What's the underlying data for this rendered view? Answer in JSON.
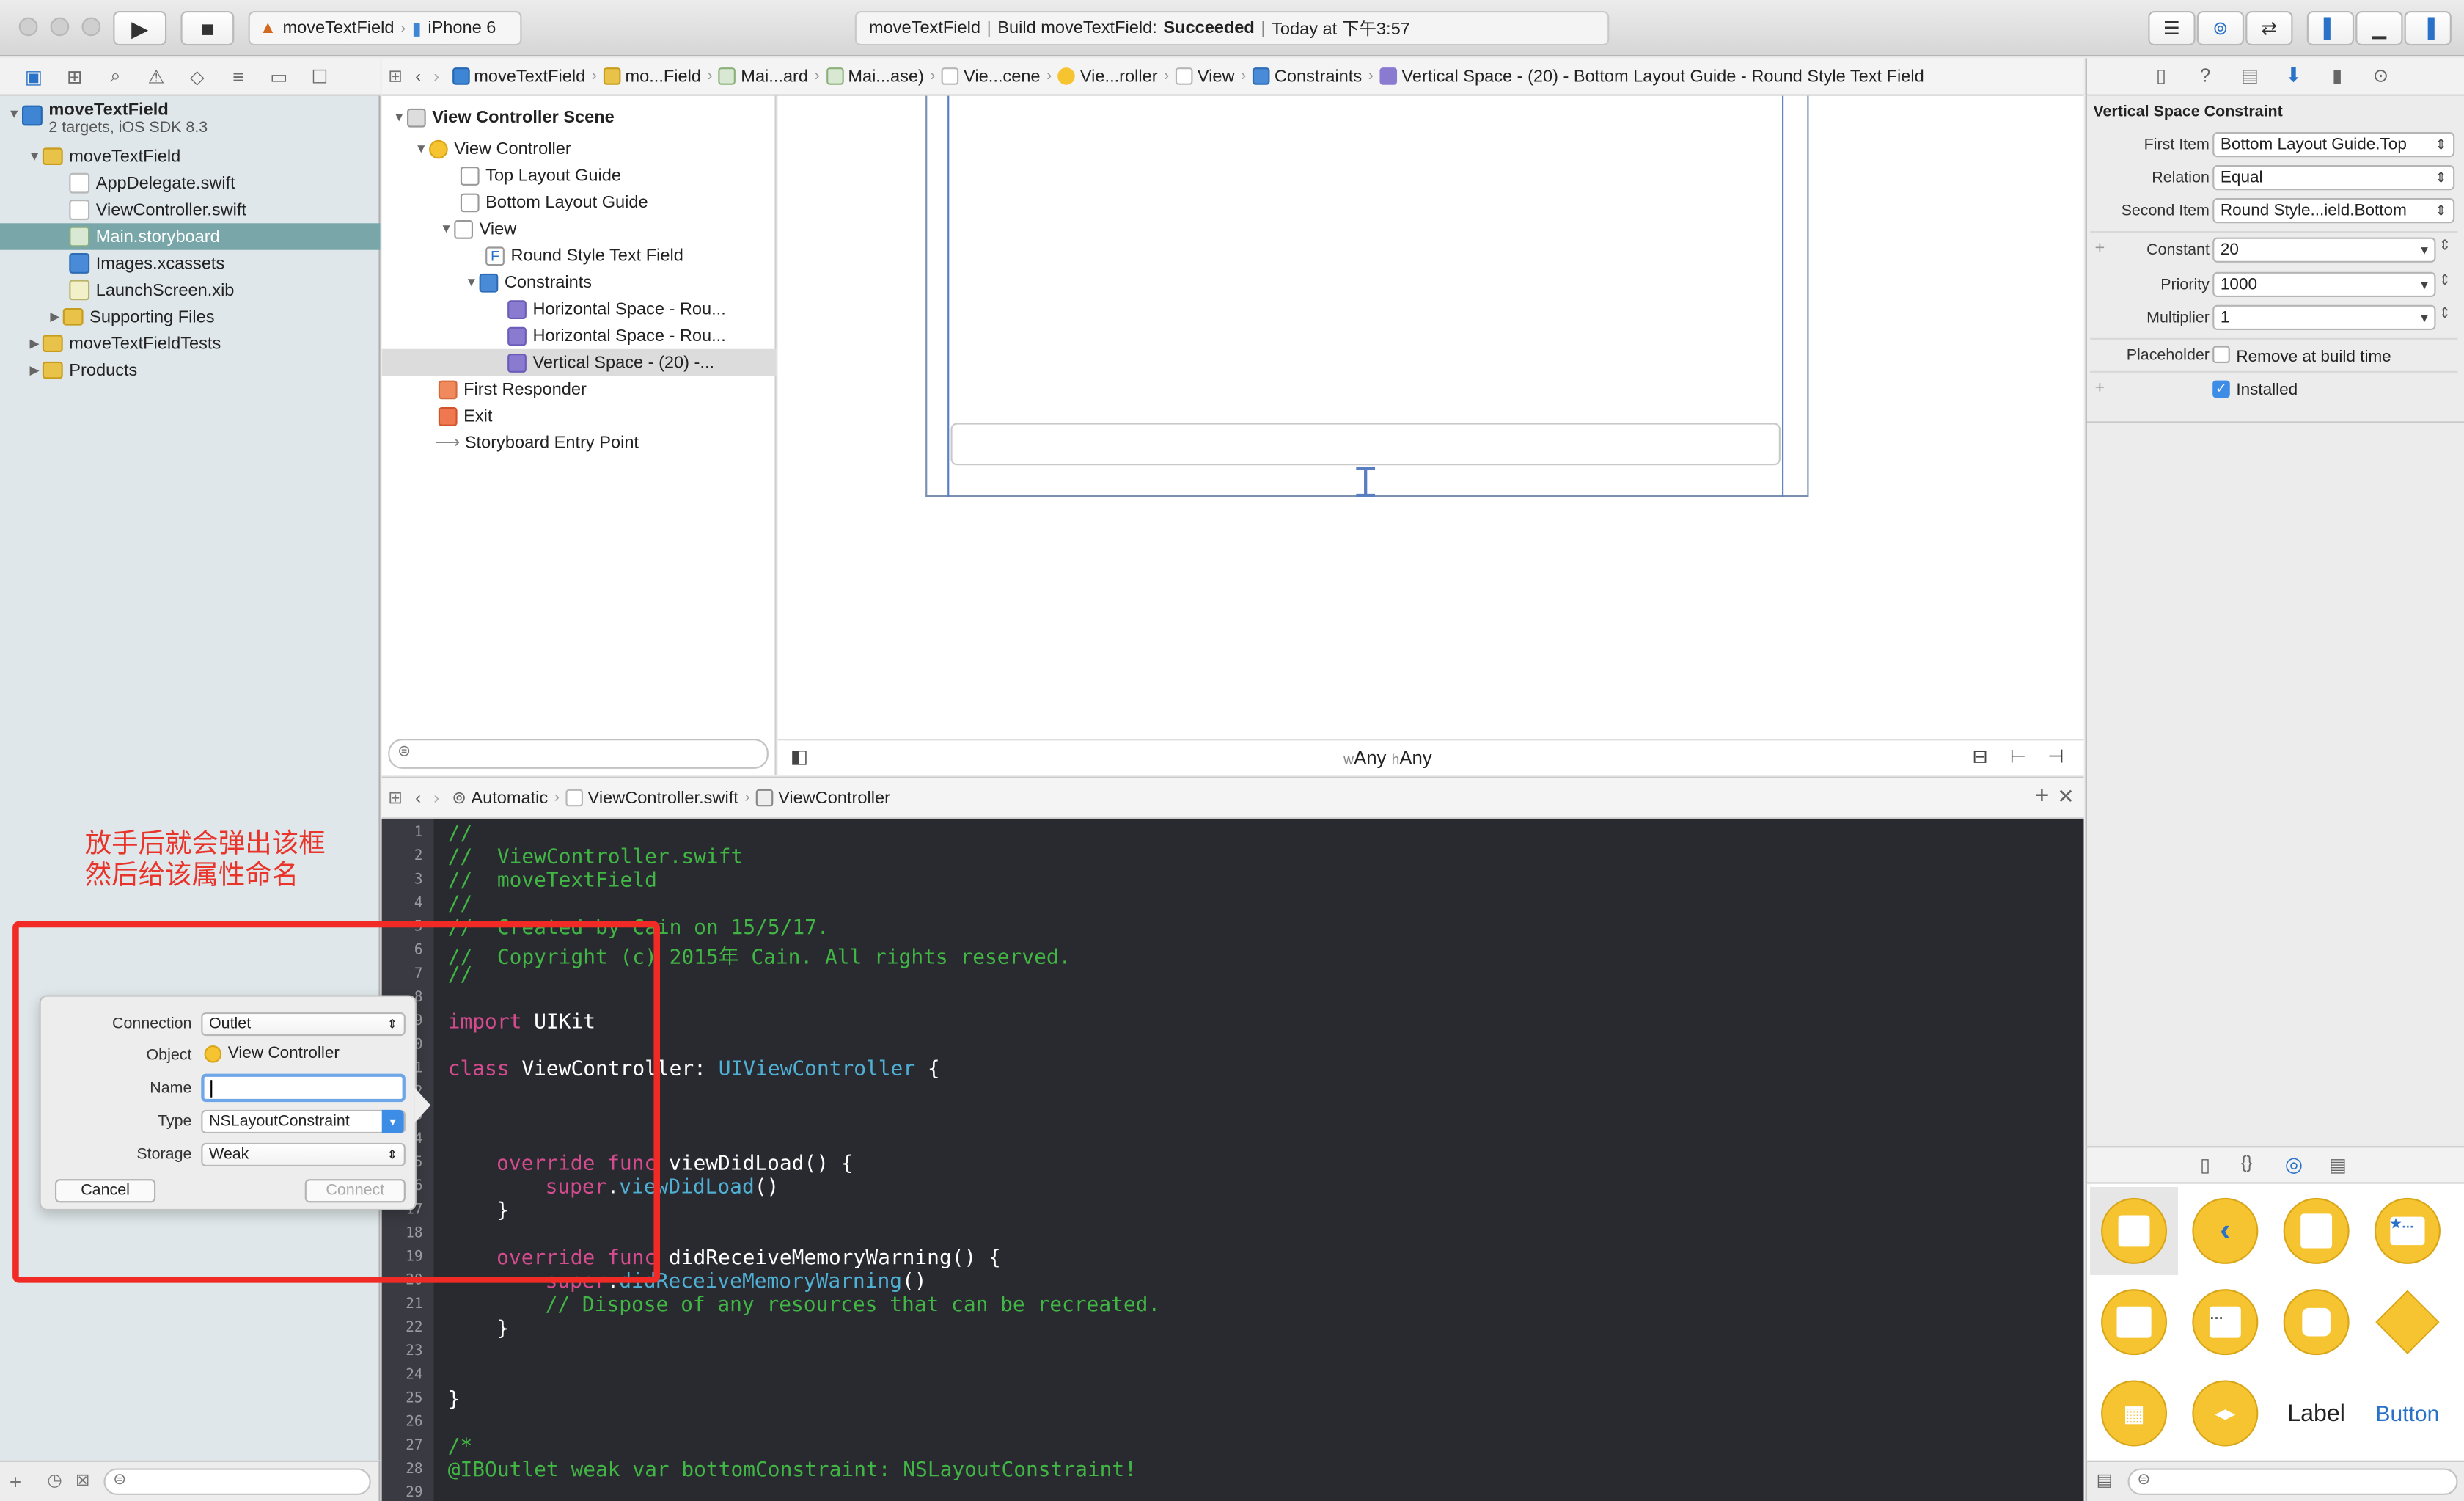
{
  "toolbar": {
    "scheme": "moveTextField",
    "device": "iPhone 6",
    "activity_project": "moveTextField",
    "activity_build": "Build moveTextField:",
    "activity_status": "Succeeded",
    "activity_time": "Today at 下午3:57"
  },
  "navigator": {
    "project": {
      "name": "moveTextField",
      "subtitle": "2 targets, iOS SDK 8.3"
    },
    "items": [
      {
        "label": "moveTextField"
      },
      {
        "label": "AppDelegate.swift"
      },
      {
        "label": "ViewController.swift"
      },
      {
        "label": "Main.storyboard"
      },
      {
        "label": "Images.xcassets"
      },
      {
        "label": "LaunchScreen.xib"
      },
      {
        "label": "Supporting Files"
      },
      {
        "label": "moveTextFieldTests"
      },
      {
        "label": "Products"
      }
    ]
  },
  "annotation": {
    "line1": "放手后就会弹出该框",
    "line2": "然后给该属性命名"
  },
  "connection_popover": {
    "connection_label": "Connection",
    "connection_value": "Outlet",
    "object_label": "Object",
    "object_value": "View Controller",
    "name_label": "Name",
    "name_value": "",
    "type_label": "Type",
    "type_value": "NSLayoutConstraint",
    "storage_label": "Storage",
    "storage_value": "Weak",
    "cancel": "Cancel",
    "connect": "Connect"
  },
  "ib_jumpbar": [
    "moveTextField",
    "mo...Field",
    "Mai...ard",
    "Mai...ase)",
    "Vie...cene",
    "Vie...roller",
    "View",
    "Constraints",
    "Vertical Space - (20) - Bottom Layout Guide - Round Style Text Field"
  ],
  "outline": {
    "scene": "View Controller Scene",
    "rows": [
      "View Controller",
      "Top Layout Guide",
      "Bottom Layout Guide",
      "View",
      "Round Style Text Field",
      "Constraints",
      "Horizontal Space - Rou...",
      "Horizontal Space - Rou...",
      "Vertical Space - (20) -...",
      "First Responder",
      "Exit",
      "Storyboard Entry Point"
    ]
  },
  "size_class": {
    "w_prefix": "w",
    "w": "Any",
    "h_prefix": "h",
    "h": "Any"
  },
  "assistant_jumpbar": [
    "Automatic",
    "ViewController.swift",
    "ViewController"
  ],
  "code": {
    "line_numbers": [
      "1",
      "2",
      "3",
      "4",
      "5",
      "6",
      "7",
      "8",
      "9",
      "10",
      "11",
      "12",
      "13",
      "14",
      "15",
      "16",
      "17",
      "18",
      "19",
      "20",
      "21",
      "22",
      "23",
      "24",
      "25",
      "26",
      "27",
      "28",
      "29"
    ],
    "l1": "//",
    "l2": "//  ViewController.swift",
    "l3": "//  moveTextField",
    "l4": "//",
    "l5": "//  Created by Cain on 15/5/17.",
    "l6": "//  Copyright (c) 2015年 Cain. All rights reserved.",
    "l7": "//",
    "l9_kw": "import",
    "l9_tx": " UIKit",
    "l11_kw": "class",
    "l11_tx": " ViewController: ",
    "l11_ty": "UIViewController",
    "l11_end": " {",
    "l15_kw": "override func",
    "l15_tx": " viewDidLoad() {",
    "l16_kw": "super",
    "l16_tx": ".",
    "l16_ty": "viewDidLoad",
    "l16_end": "()",
    "l17": "}",
    "l19_kw": "override func",
    "l19_tx": " didReceiveMemoryWarning() {",
    "l20_kw": "super",
    "l20_tx": ".",
    "l20_ty": "didReceiveMemoryWarning",
    "l20_end": "()",
    "l21": "// Dispose of any resources that can be recreated.",
    "l22": "}",
    "l25": "}",
    "l27": "/*",
    "l28": "@IBOutlet weak var bottomConstraint: NSLayoutConstraint!"
  },
  "inspector": {
    "title": "Vertical Space Constraint",
    "first_item_label": "First Item",
    "first_item": "Bottom Layout Guide.Top",
    "relation_label": "Relation",
    "relation": "Equal",
    "second_item_label": "Second Item",
    "second_item": "Round Style...ield.Bottom",
    "constant_label": "Constant",
    "constant": "20",
    "priority_label": "Priority",
    "priority": "1000",
    "multiplier_label": "Multiplier",
    "multiplier": "1",
    "placeholder_label": "Placeholder",
    "remove_label": "Remove at build time",
    "installed_label": "Installed"
  },
  "library": {
    "label_item": "Label",
    "button_item": "Button"
  }
}
